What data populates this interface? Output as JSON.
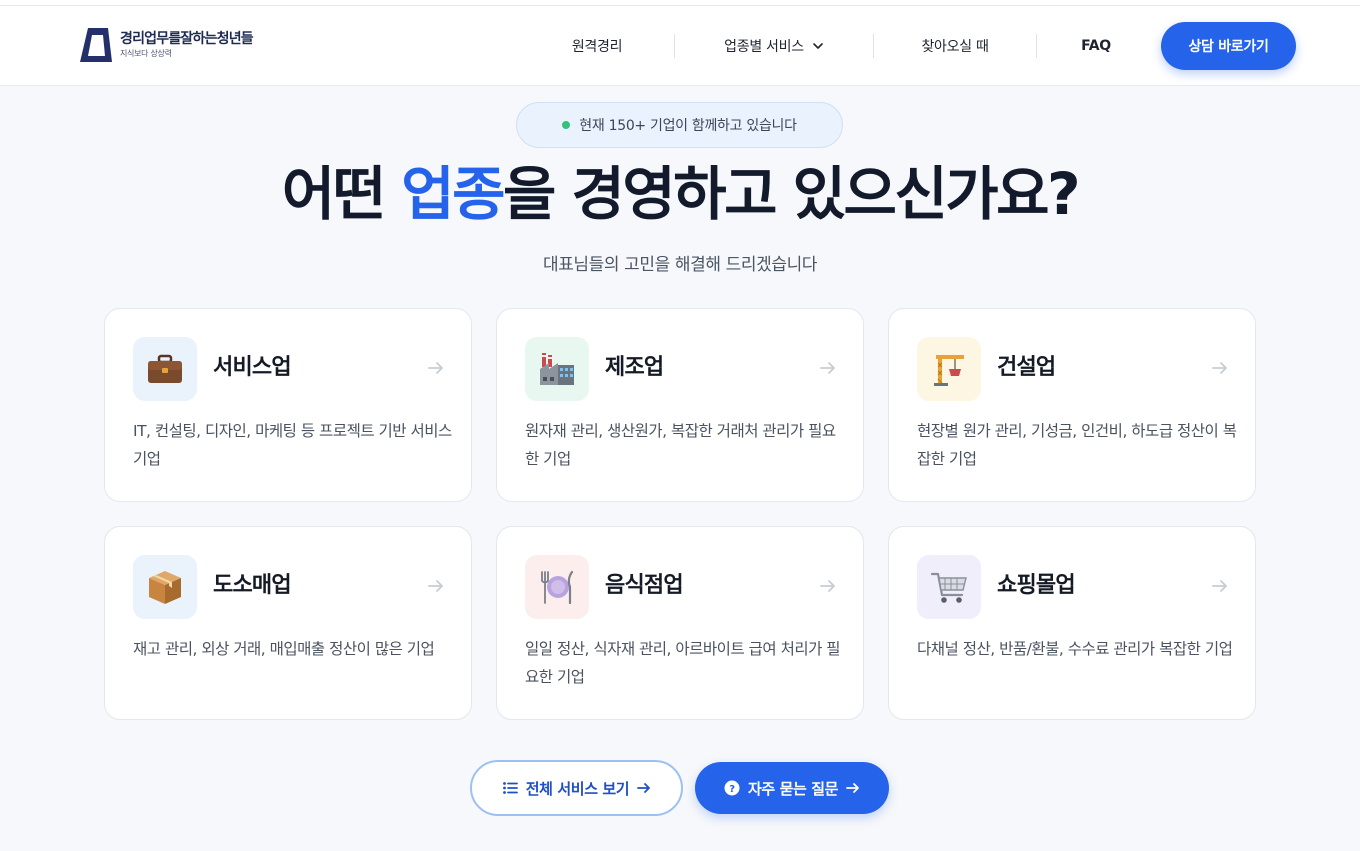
{
  "brand": {
    "name": "경리업무를잘하는청년들",
    "tagline": "지식보다 상상력"
  },
  "nav": {
    "items": [
      "원격경리",
      "업종별 서비스",
      "찾아오실 때",
      "FAQ"
    ],
    "cta": "상담 바로가기"
  },
  "hero": {
    "pill": "현재 150+ 기업이 함께하고 있습니다",
    "headline_before": "어떤 ",
    "headline_highlight": "업종",
    "headline_after": "을 경영하고 있으신가요?",
    "subtitle": "대표님들의 고민을 해결해 드리겠습니다"
  },
  "cards": [
    {
      "title": "서비스업",
      "desc": "IT, 컨설팅, 디자인, 마케팅 등 프로젝트 기반 서비스 기업",
      "icon": "briefcase-icon",
      "bg": "#eaf2fc"
    },
    {
      "title": "제조업",
      "desc": "원자재 관리, 생산원가, 복잡한 거래처 관리가 필요한 기업",
      "icon": "factory-icon",
      "bg": "#e8f7ef"
    },
    {
      "title": "건설업",
      "desc": "현장별 원가 관리, 기성금, 인건비, 하도급 정산이 복잡한 기업",
      "icon": "crane-icon",
      "bg": "#fdf6e3"
    },
    {
      "title": "도소매업",
      "desc": "재고 관리, 외상 거래, 매입매출 정산이 많은 기업",
      "icon": "package-icon",
      "bg": "#eaf2fc"
    },
    {
      "title": "음식점업",
      "desc": "일일 정산, 식자재 관리, 아르바이트 급여 처리가 필요한 기업",
      "icon": "plate-cutlery-icon",
      "bg": "#fdeeee"
    },
    {
      "title": "쇼핑몰업",
      "desc": "다채널 정산, 반품/환불, 수수료 관리가 복잡한 기업",
      "icon": "shopping-cart-icon",
      "bg": "#f1eefc"
    }
  ],
  "buttons": {
    "all_services": "전체 서비스 보기",
    "faq": "자주 묻는 질문"
  },
  "colors": {
    "accent": "#2563eb",
    "status_dot": "#34c17a"
  }
}
